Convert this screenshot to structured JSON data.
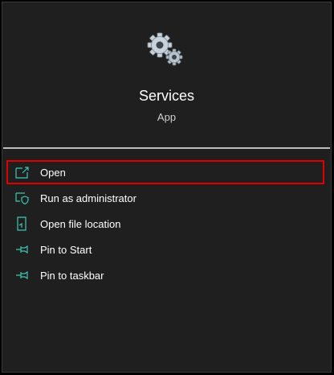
{
  "app": {
    "title": "Services",
    "subtitle": "App",
    "icon": "gears-icon"
  },
  "accent_color": "#3cc7b4",
  "selection_color": "#e00000",
  "menu": {
    "items": [
      {
        "label": "Open",
        "icon": "open-icon",
        "selected": true
      },
      {
        "label": "Run as administrator",
        "icon": "shield-icon",
        "selected": false
      },
      {
        "label": "Open file location",
        "icon": "file-location-icon",
        "selected": false
      },
      {
        "label": "Pin to Start",
        "icon": "pin-icon",
        "selected": false
      },
      {
        "label": "Pin to taskbar",
        "icon": "pin-icon",
        "selected": false
      }
    ]
  }
}
